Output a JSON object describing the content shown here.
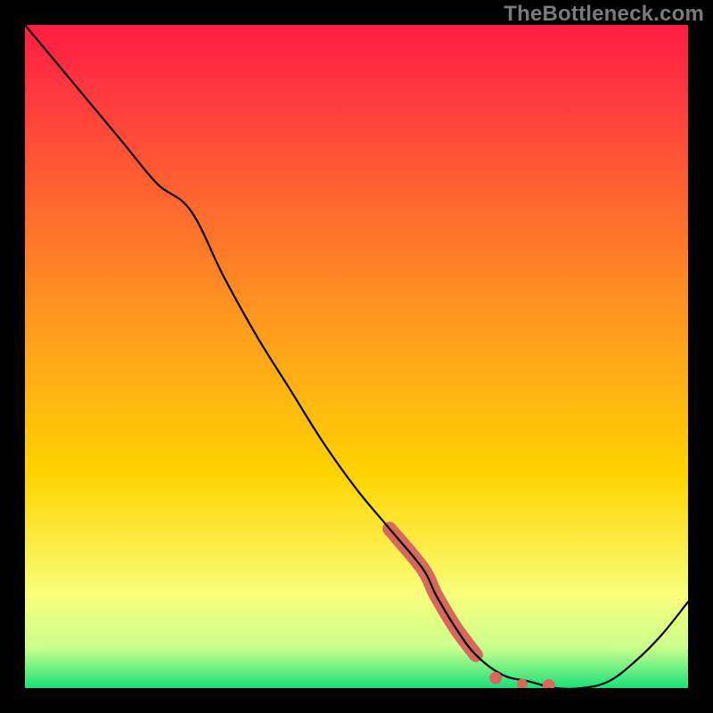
{
  "watermark": "TheBottleneck.com",
  "colors": {
    "frame": "#000000",
    "top_gradient": "#ff1c46",
    "mid_gradient": "#ffd400",
    "low_gradient": "#f8ff7a",
    "bottom_gradient": "#18e07a",
    "curve": "#000000",
    "dots": "#d6685e"
  },
  "chart_data": {
    "type": "line",
    "title": "",
    "xlabel": "",
    "ylabel": "",
    "xlim": [
      0,
      100
    ],
    "ylim": [
      0,
      100
    ],
    "x": [
      0,
      5,
      10,
      15,
      20,
      25,
      30,
      35,
      40,
      45,
      50,
      55,
      60,
      62,
      65,
      68,
      72,
      76,
      80,
      84,
      88,
      92,
      96,
      100
    ],
    "y": [
      100,
      94,
      88,
      82,
      76,
      72,
      62,
      53,
      45,
      37,
      30,
      24,
      18,
      14,
      9,
      5,
      2,
      1,
      0,
      0,
      1,
      4,
      8,
      13
    ],
    "segment_highlight": {
      "start_index": 11,
      "end_index": 15,
      "color": "#d6685e",
      "width": 16
    },
    "dots": [
      {
        "x": 71,
        "y": 1.5
      },
      {
        "x": 75,
        "y": 0.6
      },
      {
        "x": 79,
        "y": 0.4
      }
    ]
  }
}
